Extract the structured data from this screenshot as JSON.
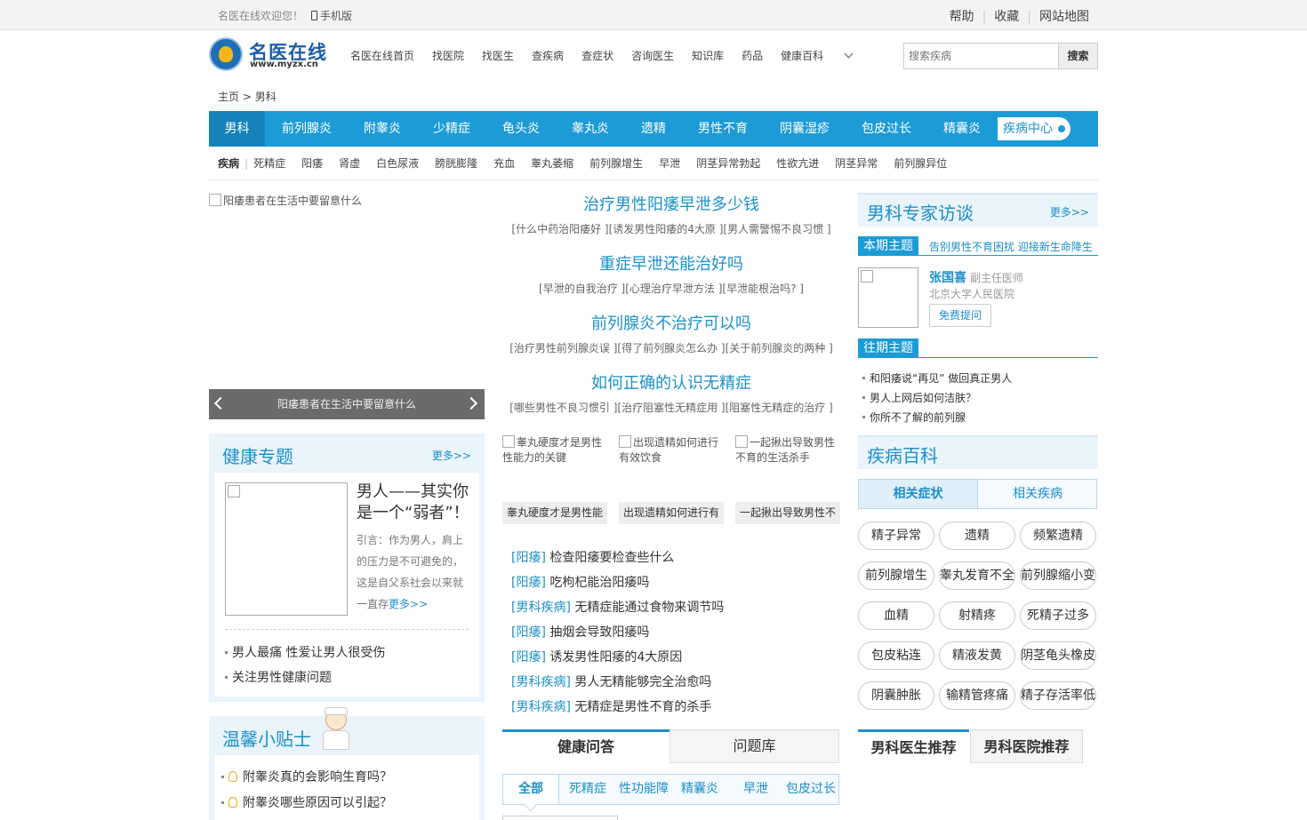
{
  "topbar": {
    "welcome": "名医在线欢迎您！",
    "mobile": "手机版",
    "links": [
      "帮助",
      "收藏",
      "网站地图"
    ]
  },
  "logo": {
    "name": "名医在线",
    "url_text": "www.myzx.cn"
  },
  "mainnav": [
    "名医在线首页",
    "找医院",
    "找医生",
    "查疾病",
    "查症状",
    "咨询医生",
    "知识库",
    "药品",
    "健康百科"
  ],
  "search": {
    "placeholder": "搜索疾病",
    "button": "搜索"
  },
  "breadcrumb": {
    "home": "主页",
    "sep": ">",
    "current": "男科"
  },
  "catbar": {
    "items": [
      "男科",
      "前列腺炎",
      "附睾炎",
      "少精症",
      "龟头炎",
      "睾丸炎",
      "遗精",
      "男性不育",
      "阴囊湿疹",
      "包皮过长",
      "精囊炎"
    ],
    "center": "疾病中心"
  },
  "subnav": {
    "head": "疾病",
    "items": [
      "死精症",
      "阳痿",
      "肾虚",
      "白色尿液",
      "膀胱膨隆",
      "充血",
      "睾丸萎缩",
      "前列腺增生",
      "早泄",
      "阴茎异常勃起",
      "性欲亢进",
      "阴茎异常",
      "前列腺异位"
    ]
  },
  "slideshow": {
    "alt": "阳痿患者在生活中要留意什么",
    "caption": "阳痿患者在生活中要留意什么"
  },
  "headlines": [
    {
      "title": "治疗男性阳痿早泄多少钱",
      "sub": "[什么中药治阳痿好 ][诱发男性阳痿的4大原 ][男人需警惕不良习惯 ]"
    },
    {
      "title": "重症早泄还能治好吗",
      "sub": "[早泄的自我治疗 ][心理治疗早泄方法 ][早泄能根治吗? ]"
    },
    {
      "title": "前列腺炎不治疗可以吗",
      "sub": "[治疗男性前列腺炎误 ][得了前列腺炎怎么办 ][关于前列腺炎的两种 ]"
    },
    {
      "title": "如何正确的认识无精症",
      "sub": "[哪些男性不良习惯引 ][治疗阻塞性无精症用 ][阻塞性无精症的治疗 ]"
    }
  ],
  "thumbs": [
    {
      "alt": "睾丸硬度才是男性性能力的关键",
      "cap": "睾丸硬度才是男性能"
    },
    {
      "alt": "出现遗精如何进行有效饮食",
      "cap": "出现遗精如何进行有"
    },
    {
      "alt": "一起揪出导致男性不育的生活杀手",
      "cap": "一起揪出导致男性不"
    }
  ],
  "articles": [
    {
      "tag": "[阳痿]",
      "title": "检查阳痿要检查些什么"
    },
    {
      "tag": "[阳痿]",
      "title": "吃枸杞能治阳痿吗"
    },
    {
      "tag": "[男科疾病]",
      "title": "无精症能通过食物来调节吗"
    },
    {
      "tag": "[阳痿]",
      "title": "抽烟会导致阳痿吗"
    },
    {
      "tag": "[阳痿]",
      "title": "诱发男性阳痿的4大原因"
    },
    {
      "tag": "[男科疾病]",
      "title": "男人无精能够完全治愈吗"
    },
    {
      "tag": "[男科疾病]",
      "title": "无精症是男性不育的杀手"
    }
  ],
  "qa": {
    "tabs": [
      "健康问答",
      "问题库"
    ],
    "sub": [
      "全部",
      "死精症",
      "性功能障",
      "精囊炎",
      "早泄",
      "包皮过长"
    ]
  },
  "health": {
    "title": "健康专题",
    "more": "更多>>",
    "feature_title": "男人——其实你是一个“弱者”！",
    "feature_desc": "引言：作为男人，肩上的压力是不可避免的，这是自父系社会以来就一直存",
    "feature_more": "更多>>",
    "links": [
      "男人最痛 性爱让男人很受伤",
      "关注男性健康问题"
    ]
  },
  "tips": {
    "title": "温馨小贴士",
    "items": [
      "附睾炎真的会影响生育吗？",
      "附睾炎哪些原因可以引起？"
    ]
  },
  "expert": {
    "title": "男科专家访谈",
    "more": "更多>>",
    "current_label": "本期主题",
    "current_topic": "告别男性不育困扰 迎接新生命降生",
    "name": "张国喜",
    "job": "副主任医师",
    "hospital": "北京大学人民医院",
    "ask": "免费提问",
    "past_label": "往期主题",
    "past": [
      "和阳痿说“再见” 做回真正男人",
      "男人上网后如何洁肤？",
      "你所不了解的前列腺"
    ]
  },
  "disease": {
    "title": "疾病百科",
    "tabs": [
      "相关症状",
      "相关疾病"
    ],
    "pills": [
      "精子异常",
      "遗精",
      "频繁遗精",
      "前列腺增生",
      "睾丸发育不全",
      "前列腺缩小变",
      "血精",
      "射精疼",
      "死精子过多",
      "包皮粘连",
      "精液发黄",
      "阴茎龟头橡皮",
      "阴囊肿胀",
      "输精管疼痛",
      "精子存活率低"
    ]
  },
  "recommend": [
    "男科医生推荐",
    "男科医院推荐"
  ]
}
